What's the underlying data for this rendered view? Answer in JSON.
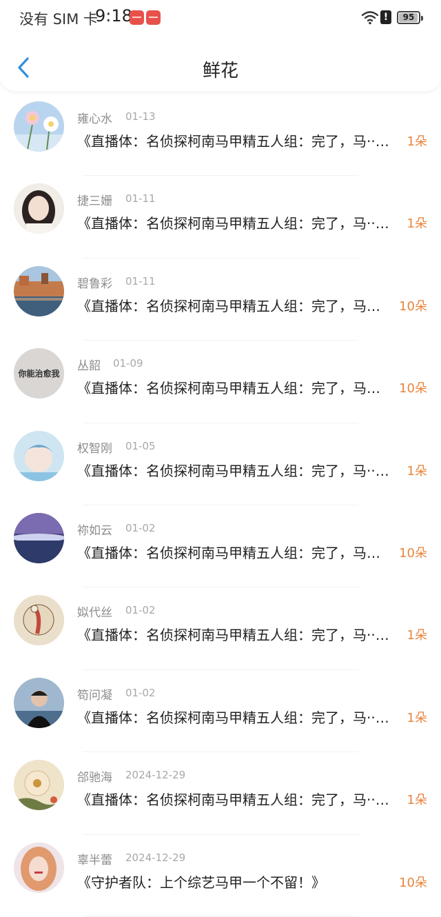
{
  "status_bar": {
    "carrier": "没有 SIM 卡",
    "time": "9:18",
    "battery": "95",
    "battery_level": 0.95
  },
  "header": {
    "title": "鲜花",
    "back_icon": "chevron-left-icon"
  },
  "colors": {
    "accent": "#2f8fde",
    "flower_count": "#e8833a",
    "name_gray": "#8c8c8c"
  },
  "items": [
    {
      "name": "雍心水",
      "date": "01-13",
      "title": "《直播体：名侦探柯南马甲精五人组：完了，马··…",
      "count": "1朵",
      "avatar": "flowers-photo"
    },
    {
      "name": "捷三姗",
      "date": "01-11",
      "title": "《直播体：名侦探柯南马甲精五人组：完了，马··…",
      "count": "1朵",
      "avatar": "girl-portrait"
    },
    {
      "name": "碧鲁彩",
      "date": "01-11",
      "title": "《直播体：名侦探柯南马甲精五人组：完了，马…",
      "count": "10朵",
      "avatar": "city-waterfront"
    },
    {
      "name": "丛韶",
      "date": "01-09",
      "title": "《直播体：名侦探柯南马甲精五人组：完了，马…",
      "count": "10朵",
      "avatar": "text-avatar",
      "avatar_text": "你能治愈我"
    },
    {
      "name": "权智刚",
      "date": "01-05",
      "title": "《直播体：名侦探柯南马甲精五人组：完了，马··…",
      "count": "1朵",
      "avatar": "anime-boy"
    },
    {
      "name": "祢如云",
      "date": "01-02",
      "title": "《直播体：名侦探柯南马甲精五人组：完了，马…",
      "count": "10朵",
      "avatar": "night-lake"
    },
    {
      "name": "姒代丝",
      "date": "01-02",
      "title": "《直播体：名侦探柯南马甲精五人组：完了，马··…",
      "count": "1朵",
      "avatar": "drawing-illustration"
    },
    {
      "name": "笱问凝",
      "date": "01-02",
      "title": "《直播体：名侦探柯南马甲精五人组：完了，马··…",
      "count": "1朵",
      "avatar": "man-portrait"
    },
    {
      "name": "郃驰海",
      "date": "2024-12-29",
      "title": "《直播体：名侦探柯南马甲精五人组：完了，马··…",
      "count": "1朵",
      "avatar": "flower-painting"
    },
    {
      "name": "辜半蕾",
      "date": "2024-12-29",
      "title": "《守护者队：上个综艺马甲一个不留！》",
      "count": "10朵",
      "avatar": "woman-portrait"
    }
  ]
}
